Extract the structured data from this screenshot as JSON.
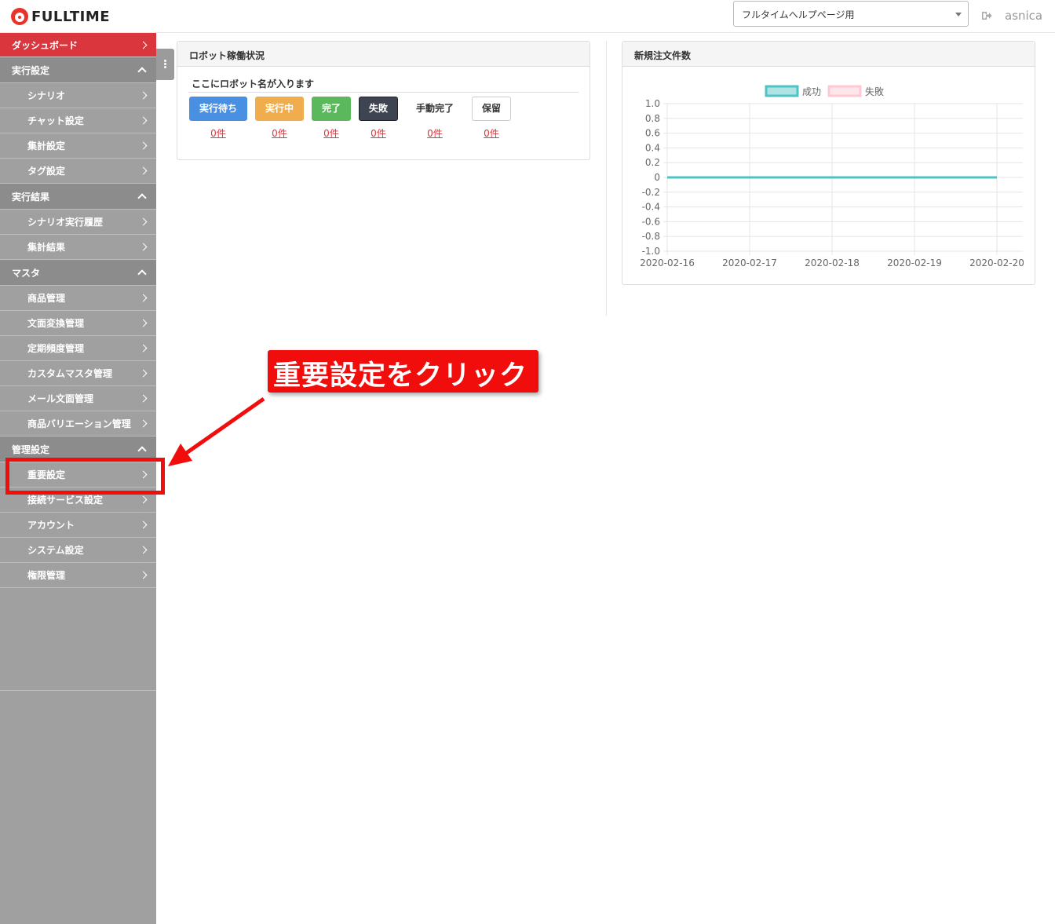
{
  "header": {
    "logo_text": "FULLTIME",
    "org_select_value": "フルタイムヘルプページ用",
    "username": "asnica"
  },
  "sidebar": {
    "dashboard": "ダッシュボード",
    "sections": [
      {
        "title": "実行設定",
        "items": [
          "シナリオ",
          "チャット設定",
          "集計設定",
          "タグ設定"
        ]
      },
      {
        "title": "実行結果",
        "items": [
          "シナリオ実行履歴",
          "集計結果"
        ]
      },
      {
        "title": "マスタ",
        "items": [
          "商品管理",
          "文面変換管理",
          "定期頻度管理",
          "カスタムマスタ管理",
          "メール文面管理",
          "商品バリエーション管理"
        ]
      },
      {
        "title": "管理設定",
        "items": [
          "重要設定",
          "接続サービス設定",
          "アカウント",
          "システム設定",
          "権限管理"
        ]
      }
    ]
  },
  "robot_panel": {
    "title": "ロボット稼働状況",
    "robot_name": "ここにロボット名が入ります",
    "statuses": [
      {
        "label": "実行待ち",
        "count": "0件",
        "color": "#4a90e2"
      },
      {
        "label": "実行中",
        "count": "0件",
        "color": "#f0ad4e"
      },
      {
        "label": "完了",
        "count": "0件",
        "color": "#5cb85c"
      },
      {
        "label": "失敗",
        "count": "0件",
        "color": "#3e4452"
      },
      {
        "label": "手動完了",
        "count": "0件",
        "color": "#ffffff"
      },
      {
        "label": "保留",
        "count": "0件",
        "color": "#ffffff"
      }
    ]
  },
  "orders_panel": {
    "title": "新規注文件数"
  },
  "chart_data": {
    "type": "line",
    "x": [
      "2020-02-16",
      "2020-02-17",
      "2020-02-18",
      "2020-02-19",
      "2020-02-20"
    ],
    "series": [
      {
        "name": "成功",
        "values": [
          0,
          0,
          0,
          0,
          0
        ],
        "color": "#4fc3c3"
      },
      {
        "name": "失敗",
        "values": [
          0,
          0,
          0,
          0,
          0
        ],
        "color": "#ffc8d2"
      }
    ],
    "ylim": [
      -1.0,
      1.0
    ],
    "yticks": [
      "1.0",
      "0.8",
      "0.6",
      "0.4",
      "0.2",
      "0",
      "-0.2",
      "-0.4",
      "-0.6",
      "-0.8",
      "-1.0"
    ],
    "legend": "top",
    "grid": true
  },
  "annotation": {
    "text": "重要設定をクリック"
  }
}
